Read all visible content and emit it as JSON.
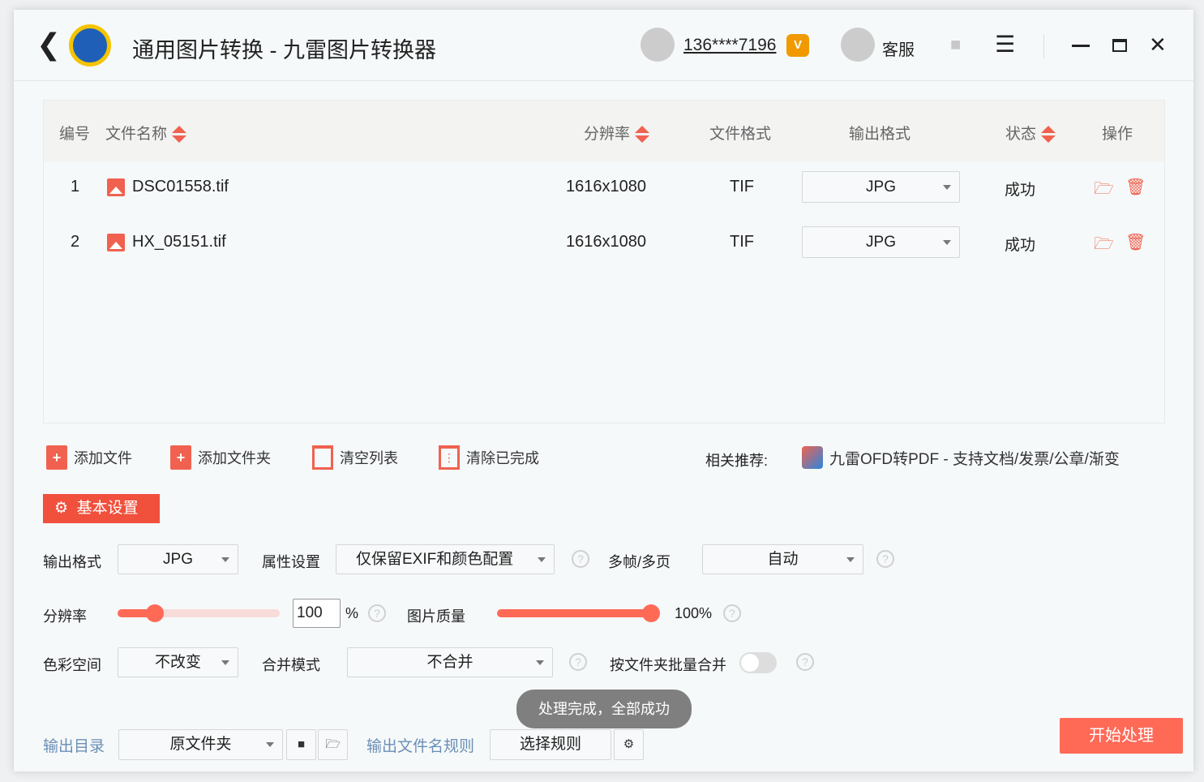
{
  "header": {
    "title": "通用图片转换 - 九雷图片转换器",
    "user": "136****7196",
    "vip_badge": "V",
    "support": "客服"
  },
  "table": {
    "columns": {
      "index": "编号",
      "name": "文件名称",
      "resolution": "分辨率",
      "format": "文件格式",
      "output": "输出格式",
      "status": "状态",
      "actions": "操作"
    },
    "rows": [
      {
        "index": "1",
        "name": "DSC01558.tif",
        "resolution": "1616x1080",
        "format": "TIF",
        "output": "JPG",
        "status": "成功"
      },
      {
        "index": "2",
        "name": "HX_05151.tif",
        "resolution": "1616x1080",
        "format": "TIF",
        "output": "JPG",
        "status": "成功"
      }
    ]
  },
  "toolbar": {
    "add_file": "添加文件",
    "add_folder": "添加文件夹",
    "clear_list": "清空列表",
    "clear_done": "清除已完成",
    "recommend_label": "相关推荐:",
    "recommend_text": "九雷OFD转PDF - 支持文档/发票/公章/渐变"
  },
  "settings": {
    "tab": "基本设置",
    "output_format_label": "输出格式",
    "output_format": "JPG",
    "attr_label": "属性设置",
    "attr_value": "仅保留EXIF和颜色配置",
    "multiframe_label": "多帧/多页",
    "multiframe_value": "自动",
    "resolution_label": "分辨率",
    "resolution_value": "100",
    "resolution_unit": "%",
    "resolution_slider": 0.23,
    "quality_label": "图片质量",
    "quality_value": "100%",
    "quality_slider": 1.0,
    "colorspace_label": "色彩空间",
    "colorspace_value": "不改变",
    "merge_label": "合并模式",
    "merge_value": "不合并",
    "folder_merge_label": "按文件夹批量合并",
    "folder_merge_on": false,
    "output_dir_label": "输出目录",
    "output_dir_value": "原文件夹",
    "filename_rule_label": "输出文件名规则",
    "filename_rule_value": "选择规则",
    "help": "?"
  },
  "toast": "处理完成，全部成功",
  "start_button": "开始处理",
  "colors": {
    "accent": "#f0624f",
    "start": "#ff6a57"
  }
}
